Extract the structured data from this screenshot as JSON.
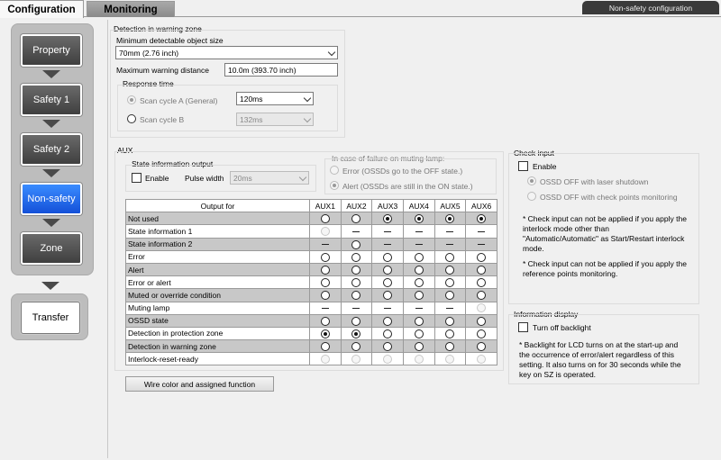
{
  "tabs": {
    "configuration": "Configuration",
    "monitoring": "Monitoring"
  },
  "mode_label": "Non-safety configuration",
  "steps": [
    "Property",
    "Safety 1",
    "Safety 2",
    "Non-safety",
    "Zone"
  ],
  "transfer": "Transfer",
  "warning_zone": {
    "title": "Detection in warning zone",
    "min_size_label": "Minimum detectable object size",
    "min_size_value": "70mm (2.76 inch)",
    "max_dist_label": "Maximum warning distance",
    "max_dist_value": "10.0m (393.70 inch)",
    "response_title": "Response time",
    "scan_a_label": "Scan cycle A (General)",
    "scan_a_value": "120ms",
    "scan_b_label": "Scan cycle B",
    "scan_b_value": "132ms"
  },
  "aux": {
    "title": "AUX",
    "state_title": "State information output",
    "enable_label": "Enable",
    "pulse_label": "Pulse width",
    "pulse_value": "20ms",
    "muting_title": "In case of failure on muting lamp:",
    "muting_error": "Error (OSSDs go to the OFF state.)",
    "muting_alert": "Alert (OSSDs are still in the ON state.)",
    "table_header": [
      "Output for",
      "AUX1",
      "AUX2",
      "AUX3",
      "AUX4",
      "AUX5",
      "AUX6"
    ],
    "rows": [
      {
        "label": "Not used",
        "cells": [
          "o",
          "o",
          "s",
          "s",
          "s",
          "s"
        ]
      },
      {
        "label": "State information 1",
        "cells": [
          "d",
          "-",
          "-",
          "-",
          "-",
          "-"
        ]
      },
      {
        "label": "State information 2",
        "cells": [
          "-",
          "o",
          "-",
          "-",
          "-",
          "-"
        ]
      },
      {
        "label": "Error",
        "cells": [
          "o",
          "o",
          "o",
          "o",
          "o",
          "o"
        ]
      },
      {
        "label": "Alert",
        "cells": [
          "o",
          "o",
          "o",
          "o",
          "o",
          "o"
        ]
      },
      {
        "label": "Error or alert",
        "cells": [
          "o",
          "o",
          "o",
          "o",
          "o",
          "o"
        ]
      },
      {
        "label": "Muted or override condition",
        "cells": [
          "o",
          "o",
          "o",
          "o",
          "o",
          "o"
        ]
      },
      {
        "label": "Muting lamp",
        "cells": [
          "-",
          "-",
          "-",
          "-",
          "-",
          "d"
        ]
      },
      {
        "label": "OSSD state",
        "cells": [
          "o",
          "o",
          "o",
          "o",
          "o",
          "o"
        ]
      },
      {
        "label": "Detection in protection zone",
        "cells": [
          "s",
          "s",
          "o",
          "o",
          "o",
          "o"
        ]
      },
      {
        "label": "Detection in warning zone",
        "cells": [
          "o",
          "o",
          "o",
          "o",
          "o",
          "o"
        ]
      },
      {
        "label": "Interlock-reset-ready",
        "cells": [
          "d",
          "d",
          "d",
          "d",
          "d",
          "d"
        ]
      }
    ],
    "wire_button": "Wire color and assigned function"
  },
  "check_input": {
    "title": "Check input",
    "enable_label": "Enable",
    "opt1": "OSSD OFF with laser shutdown",
    "opt2": "OSSD OFF with check points monitoring",
    "note1a": "* Check input can not be applied if you apply the",
    "note1b": "interlock mode other than",
    "note1c": "\"Automatic/Automatic\" as Start/Restart interlock",
    "note1d": "mode.",
    "note2a": "* Check input can not be applied if you apply the",
    "note2b": "reference  points monitoring."
  },
  "info_display": {
    "title": "Information display",
    "backlight_label": "Turn off backlight",
    "note_a": "* Backlight for LCD turns on at the start-up and",
    "note_b": "the occurrence of error/alert regardless of this",
    "note_c": "setting. It also turns on for 30 seconds while the",
    "note_d": "key on SZ is operated."
  }
}
